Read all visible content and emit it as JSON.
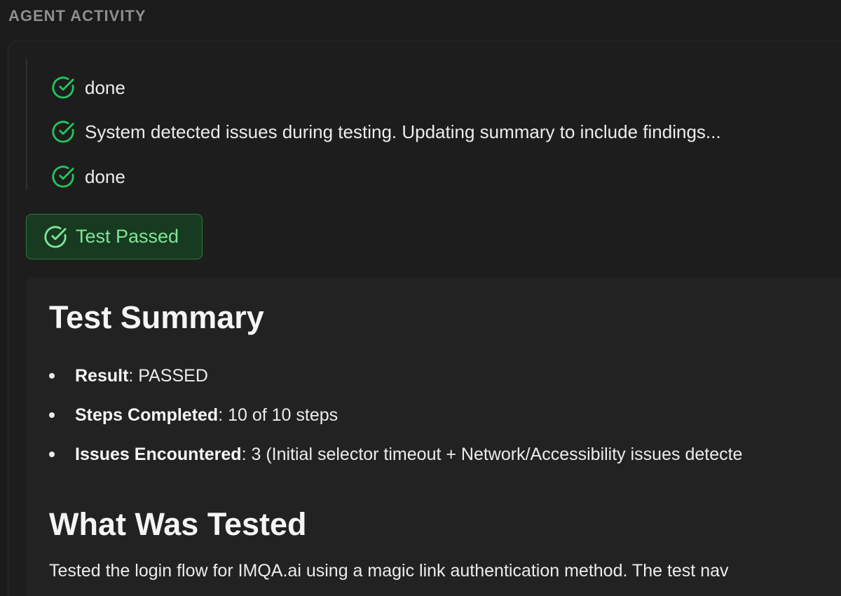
{
  "header": {
    "title": "AGENT ACTIVITY"
  },
  "activity": {
    "items": [
      {
        "text": "done",
        "icon": "check-circle-icon"
      },
      {
        "text": "System detected issues during testing. Updating summary to include findings...",
        "icon": "check-circle-icon"
      },
      {
        "text": "done",
        "icon": "check-circle-icon"
      }
    ]
  },
  "badge": {
    "label": "Test Passed",
    "icon": "check-circle-icon"
  },
  "summary": {
    "title": "Test Summary",
    "items": [
      {
        "key": "Result",
        "value": ": PASSED"
      },
      {
        "key": "Steps Completed",
        "value": ": 10 of 10 steps"
      },
      {
        "key": "Issues Encountered",
        "value": ": 3 (Initial selector timeout + Network/Accessibility issues detecte"
      }
    ]
  },
  "tested": {
    "title": "What Was Tested",
    "text": "Tested the login flow for IMQA.ai using a magic link authentication method. The test nav"
  },
  "colors": {
    "background": "#1b1b1b",
    "success_green": "#22c55e",
    "badge_text": "#7ee69a",
    "badge_bg": "#173a20"
  }
}
